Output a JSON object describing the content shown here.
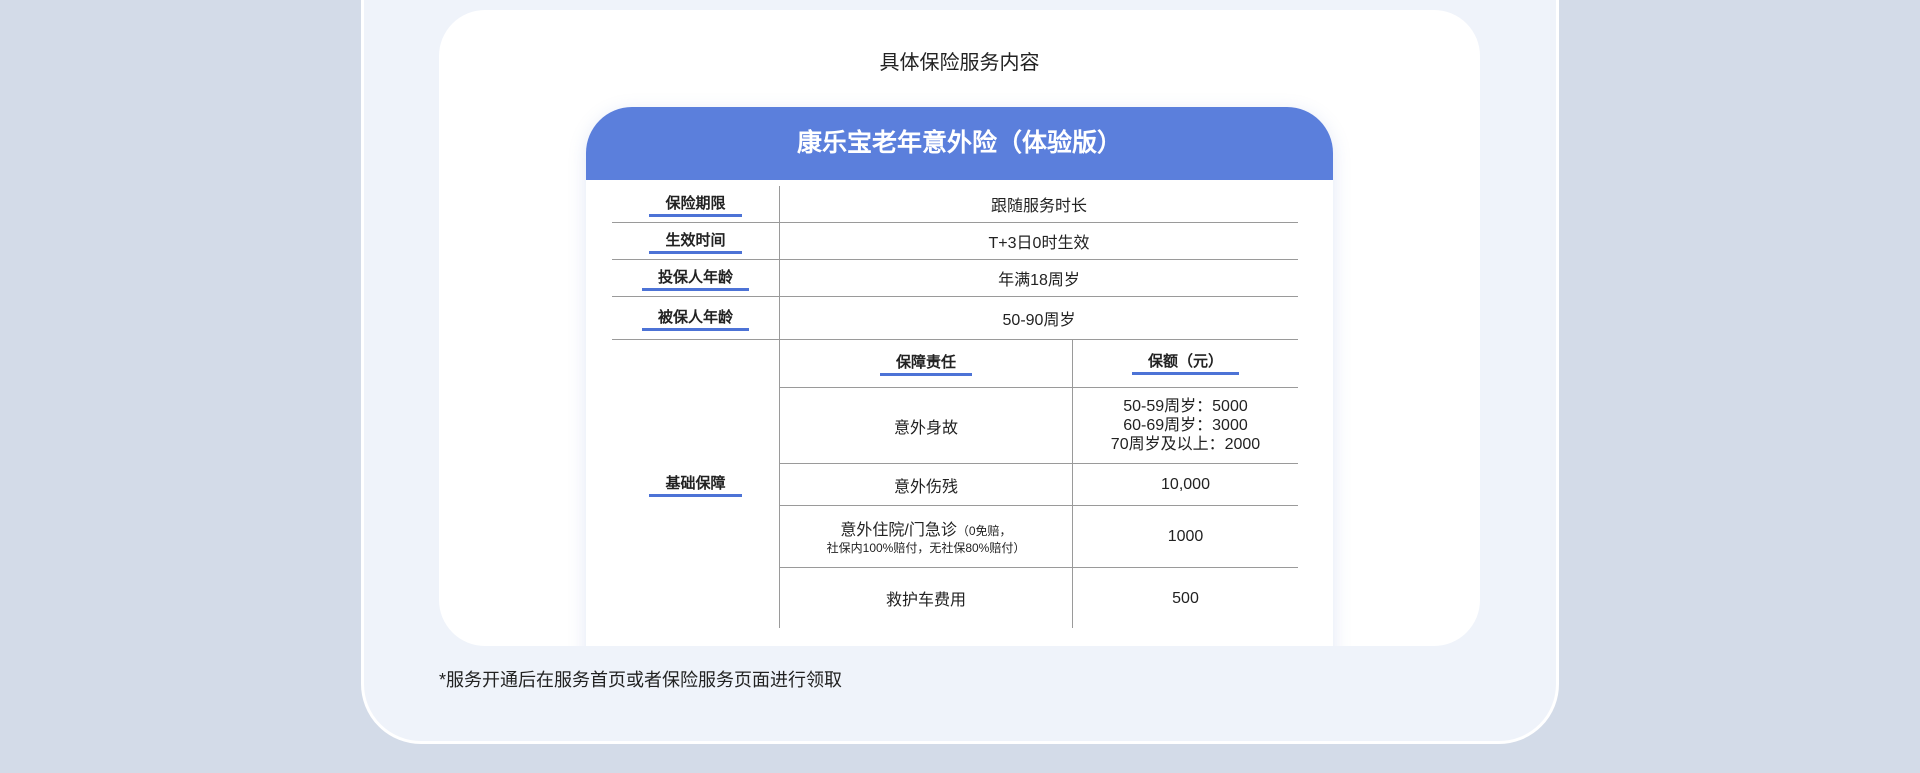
{
  "section_title": "具体保险服务内容",
  "product_title": "康乐宝老年意外险（体验版）",
  "rows": [
    {
      "label": "保险期限",
      "value": "跟随服务时长"
    },
    {
      "label": "生效时间",
      "value": "T+3日0时生效"
    },
    {
      "label": "投保人年龄",
      "value": "年满18周岁"
    },
    {
      "label": "被保人年龄",
      "value": "50-90周岁"
    }
  ],
  "basic": {
    "label": "基础保障",
    "col1_header": "保障责任",
    "col2_header": "保额（元）",
    "items": [
      {
        "name": "意外身故",
        "amount_lines": [
          "50-59周岁：5000",
          "60-69周岁：3000",
          "70周岁及以上：2000"
        ]
      },
      {
        "name": "意外伤残",
        "amount": "10,000"
      },
      {
        "name_main": "意外住院/门急诊",
        "name_note_1": "（0免赔，",
        "name_note_2": "社保内100%赔付，无社保80%赔付）",
        "amount": "1000"
      },
      {
        "name": "救护车费用",
        "amount": "500"
      }
    ]
  },
  "footnote": "*服务开通后在服务首页或者保险服务页面进行领取"
}
